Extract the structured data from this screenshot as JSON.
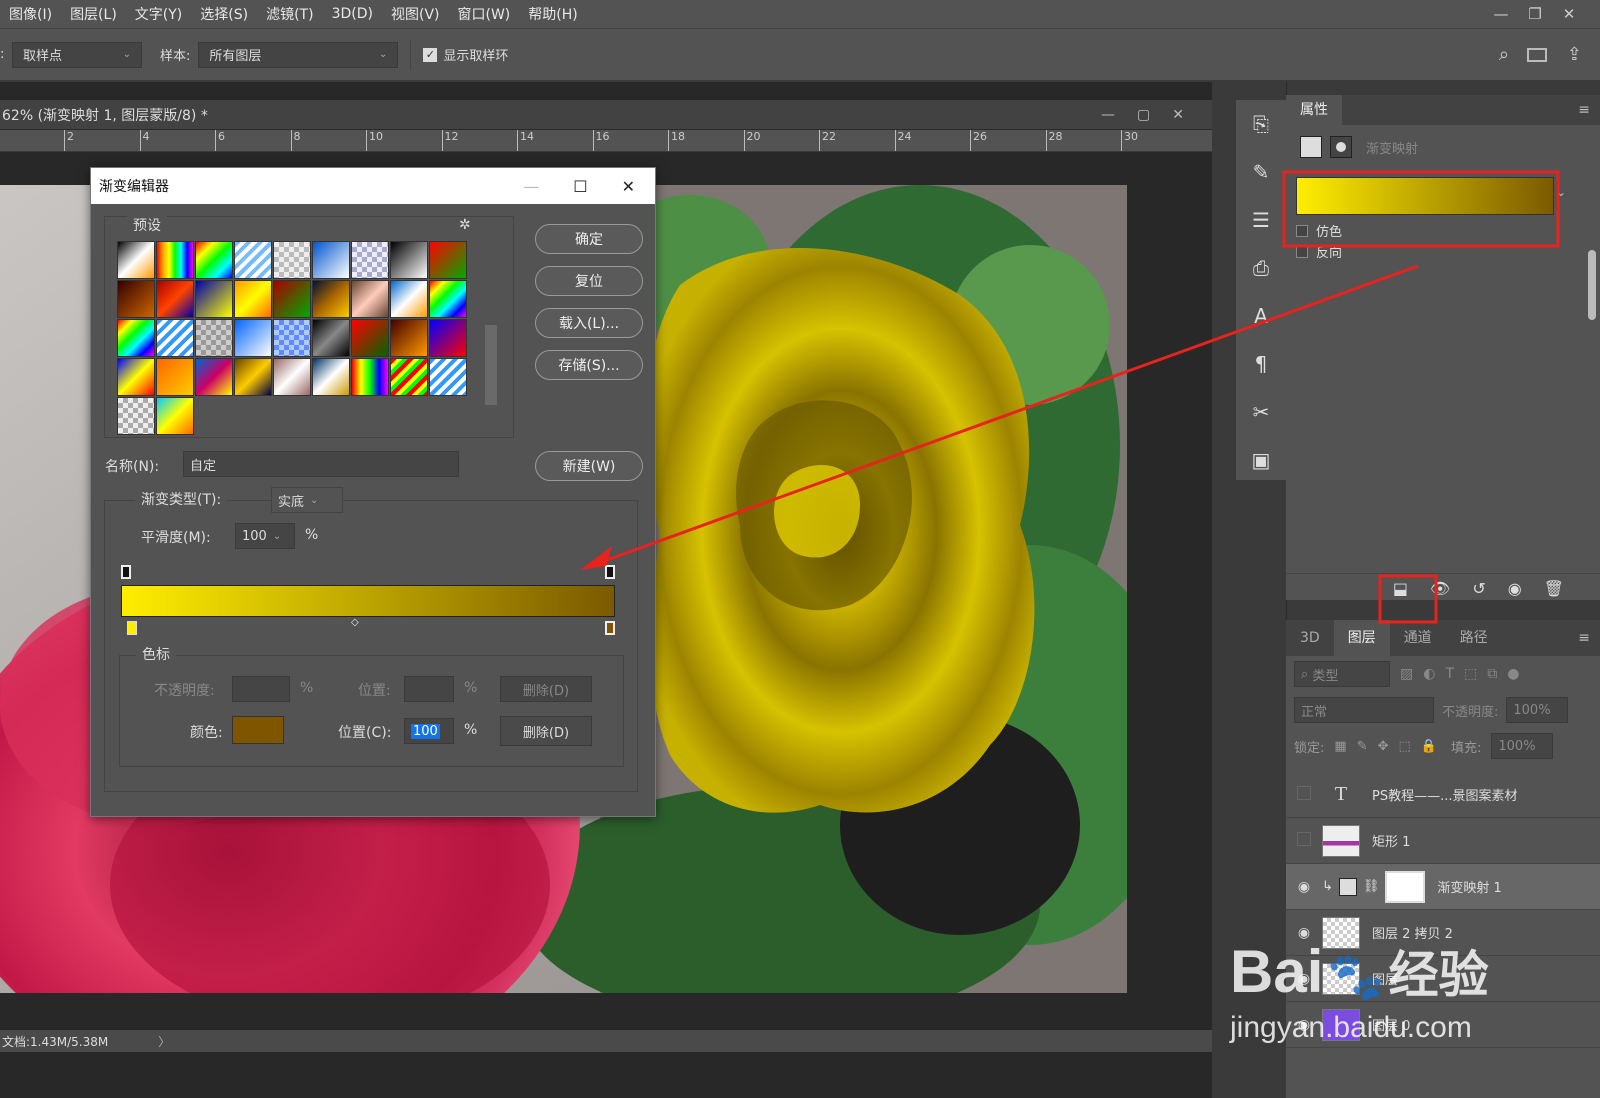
{
  "menubar": {
    "items": [
      "图像(I)",
      "图层(L)",
      "文字(Y)",
      "选择(S)",
      "滤镜(T)",
      "3D(D)",
      "视图(V)",
      "窗口(W)",
      "帮助(H)"
    ]
  },
  "options": {
    "sample_size_label": ":",
    "sample_size_value": "取样点",
    "sample_label": "样本:",
    "sample_value": "所有图层",
    "show_ring_label": "显示取样环"
  },
  "document": {
    "tab_title": "62% (渐变映射 1, 图层蒙版/8) *",
    "ruler_ticks": [
      "2",
      "4",
      "6",
      "8",
      "10",
      "12",
      "14",
      "16",
      "18",
      "20",
      "22",
      "24",
      "26",
      "28",
      "30"
    ],
    "status": "文档:1.43M/5.38M",
    "status_arrow": "〉"
  },
  "dialog": {
    "title": "渐变编辑器",
    "presets_label": "预设",
    "buttons": {
      "ok": "确定",
      "reset": "复位",
      "load": "载入(L)...",
      "save": "存储(S)...",
      "new": "新建(W)"
    },
    "name_label": "名称(N):",
    "name_value": "自定",
    "type_label": "渐变类型(T):",
    "type_value": "实底",
    "smooth_label": "平滑度(M):",
    "smooth_value": "100",
    "smooth_unit": "%",
    "stops_group_label": "色标",
    "opacity_label": "不透明度:",
    "opacity_unit": "%",
    "position_label": "位置:",
    "position_unit": "%",
    "delete_label": "删除(D)",
    "color_label": "颜色:",
    "color_position_label": "位置(C):",
    "color_position_value": "100",
    "color_position_unit": "%",
    "color_delete_label": "删除(D)",
    "gradient_start": "#ffee00",
    "gradient_end": "#7a5a00",
    "stop_color": "#7f5500"
  },
  "properties": {
    "panel_title": "属性",
    "type_label": "渐变映射",
    "dither_label": "仿色",
    "reverse_label": "反向"
  },
  "layers": {
    "tabs": [
      "3D",
      "图层",
      "通道",
      "路径"
    ],
    "active_tab": "图层",
    "filter_label": "类型",
    "blend_mode": "正常",
    "opacity_label": "不透明度:",
    "opacity_value": "100%",
    "lock_label": "锁定:",
    "fill_label": "填充:",
    "fill_value": "100%",
    "rows": [
      {
        "name": "PS教程——...景图案素材",
        "visible": false,
        "kind": "text"
      },
      {
        "name": "矩形 1",
        "visible": false,
        "kind": "shape"
      },
      {
        "name": "渐变映射 1",
        "visible": true,
        "kind": "adjust"
      },
      {
        "name": "图层 2 拷贝 2",
        "visible": true,
        "kind": "pixel"
      },
      {
        "name": "图层",
        "visible": true,
        "kind": "pixel"
      },
      {
        "name": "图层 0",
        "visible": true,
        "kind": "pixel"
      }
    ]
  },
  "watermark": {
    "brand": "Bai",
    "brand2": "经验",
    "url": "jingyan.baidu.com"
  },
  "colors": {
    "highlight_red": "#e8221c",
    "accent_blue": "#1473e6"
  }
}
